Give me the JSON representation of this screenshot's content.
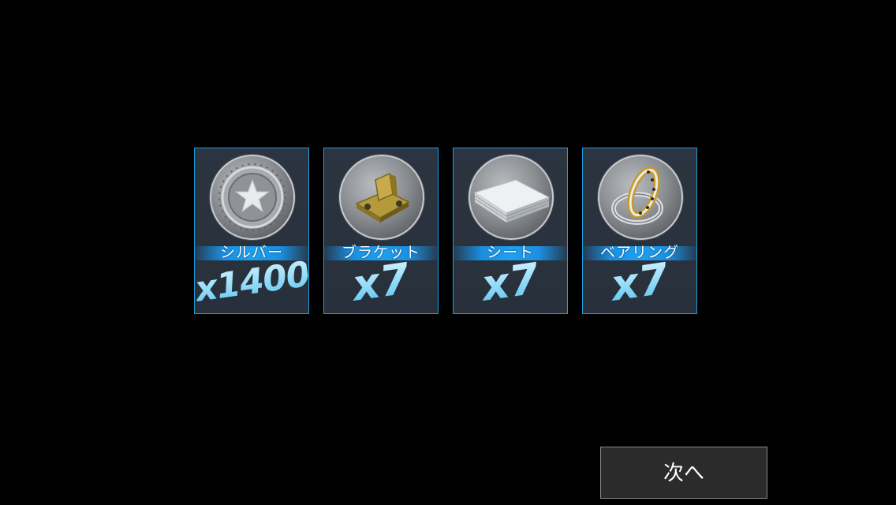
{
  "rewards": [
    {
      "name": "シルバー",
      "quantity": "x1400",
      "icon": "silver-coin-icon"
    },
    {
      "name": "ブラケット",
      "quantity": "x7",
      "icon": "bracket-icon"
    },
    {
      "name": "シート",
      "quantity": "x7",
      "icon": "sheet-icon"
    },
    {
      "name": "ベアリング",
      "quantity": "x7",
      "icon": "bearing-icon"
    }
  ],
  "next_button": {
    "label": "次へ"
  },
  "colors": {
    "card_border": "#1c9fe0",
    "label_band": "#1fa0ef",
    "quantity_text": "#6ed0f5",
    "background": "#000000"
  }
}
